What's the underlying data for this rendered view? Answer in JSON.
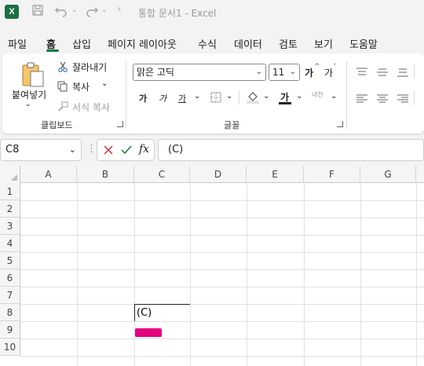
{
  "titlebar": {
    "app_icon_letter": "X",
    "title": "통합 문서1  -  Excel"
  },
  "tabs": [
    "파일",
    "홈",
    "삽입",
    "페이지 레이아웃",
    "수식",
    "데이터",
    "검토",
    "보기",
    "도움말"
  ],
  "active_tab": "홈",
  "ribbon": {
    "clipboard": {
      "paste_label": "붙여넣기",
      "cut_label": "잘라내기",
      "copy_label": "복사",
      "format_painter_label": "서식 복사",
      "group_label": "클립보드"
    },
    "font": {
      "font_name": "맑은 고딕",
      "font_size": "11",
      "bold_label": "가",
      "italic_label": "가",
      "underline_label": "가",
      "phonetic_label": "내천",
      "grow_label": "가",
      "shrink_label": "가",
      "font_color_label": "가",
      "group_label": "글꼴"
    }
  },
  "formula_bar": {
    "name_box": "C8",
    "fx_label": "fx",
    "formula": "(C)"
  },
  "columns": [
    "A",
    "B",
    "C",
    "D",
    "E",
    "F",
    "G"
  ],
  "rows": [
    "1",
    "2",
    "3",
    "4",
    "5",
    "6",
    "7",
    "8",
    "9",
    "10"
  ],
  "cells": {
    "C8": "(C)"
  },
  "colors": {
    "accent": "#107c41",
    "highlight": "#e6007e"
  }
}
